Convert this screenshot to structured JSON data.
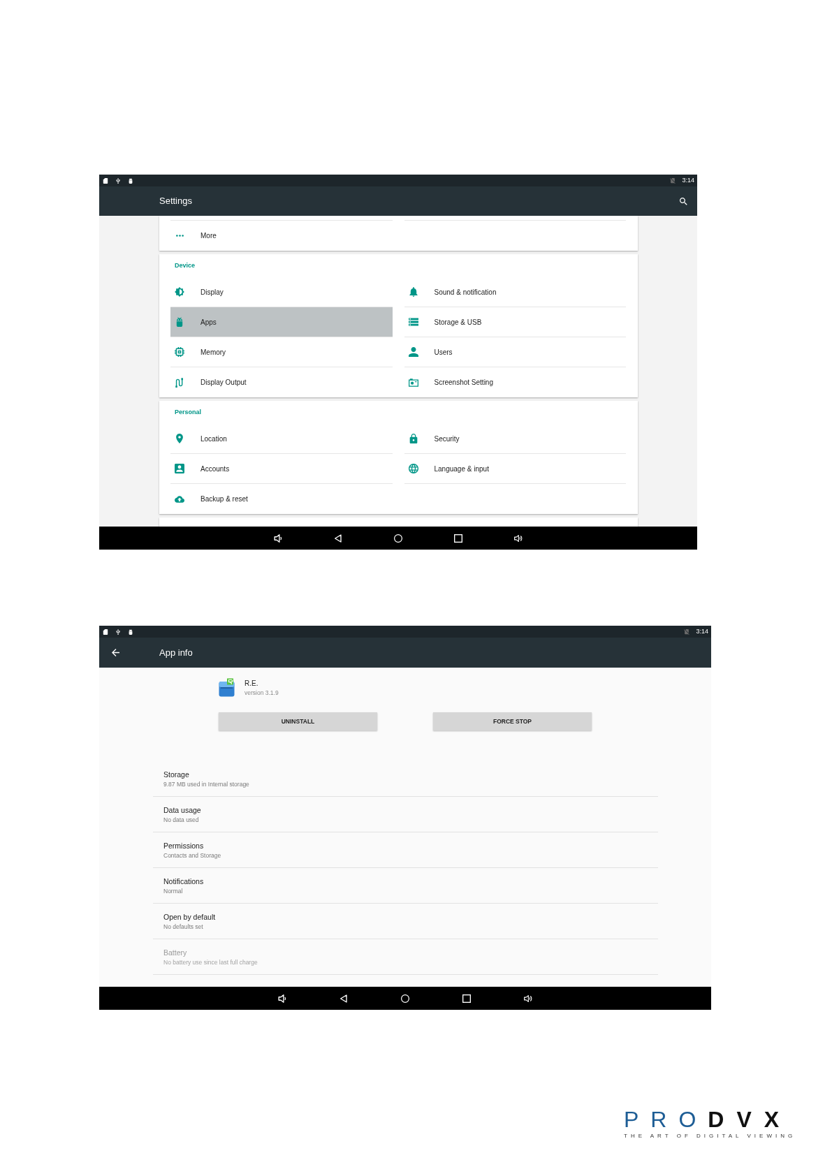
{
  "settings_screen": {
    "status_bar": {
      "time": "3:14"
    },
    "toolbar": {
      "title": "Settings"
    },
    "cards": [
      {
        "items": [
          {
            "label": "More",
            "selected": false
          }
        ]
      },
      {
        "header": "Device",
        "items": [
          {
            "label": "Display",
            "selected": false
          },
          {
            "label": "Sound & notification",
            "selected": false
          },
          {
            "label": "Apps",
            "selected": true
          },
          {
            "label": "Storage & USB",
            "selected": false
          },
          {
            "label": "Memory",
            "selected": false
          },
          {
            "label": "Users",
            "selected": false
          },
          {
            "label": "Display Output",
            "selected": false
          },
          {
            "label": "Screenshot Setting",
            "selected": false
          }
        ]
      },
      {
        "header": "Personal",
        "items": [
          {
            "label": "Location",
            "selected": false
          },
          {
            "label": "Security",
            "selected": false
          },
          {
            "label": "Accounts",
            "selected": false
          },
          {
            "label": "Language & input",
            "selected": false
          },
          {
            "label": "Backup & reset",
            "selected": false
          }
        ]
      }
    ]
  },
  "app_info_screen": {
    "status_bar": {
      "time": "3:14"
    },
    "toolbar": {
      "title": "App info"
    },
    "app": {
      "name": "R.E.",
      "version": "version 3.1.9"
    },
    "buttons": [
      "UNINSTALL",
      "FORCE STOP"
    ],
    "rows": [
      {
        "title": "Storage",
        "summary": "9.87 MB used in Internal storage",
        "disabled": false
      },
      {
        "title": "Data usage",
        "summary": "No data used",
        "disabled": false
      },
      {
        "title": "Permissions",
        "summary": "Contacts and Storage",
        "disabled": false
      },
      {
        "title": "Notifications",
        "summary": "Normal",
        "disabled": false
      },
      {
        "title": "Open by default",
        "summary": "No defaults set",
        "disabled": false
      },
      {
        "title": "Battery",
        "summary": "No battery use since last full charge",
        "disabled": true
      }
    ]
  },
  "logo": {
    "wordmark_left": "PRO",
    "wordmark_right": "DVX",
    "tagline": "THE ART OF DIGITAL VIEWING"
  }
}
